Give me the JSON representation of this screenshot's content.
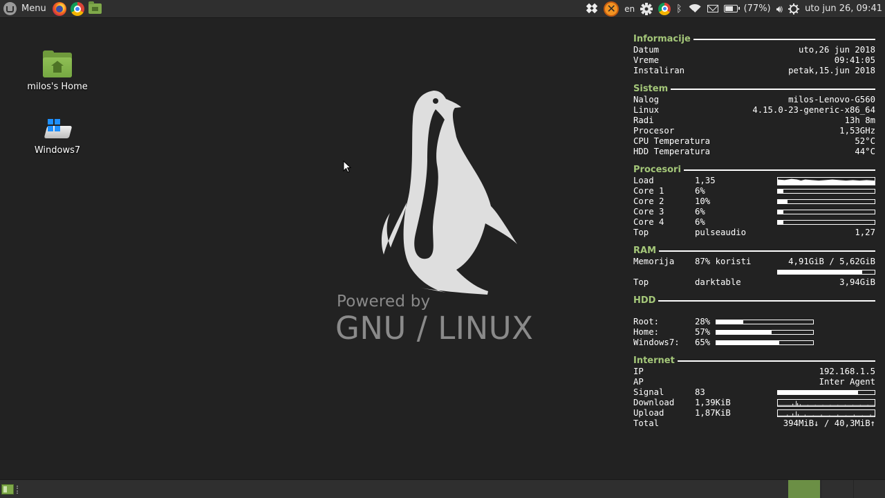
{
  "top_panel": {
    "menu_label": "Menu",
    "language": "en",
    "battery_text": "(77%)",
    "battery_level": 0.77,
    "clock": "uto jun 26, 09:41"
  },
  "desktop_icons": [
    {
      "label": "milos's Home",
      "icon": "home-folder-icon"
    },
    {
      "label": "Windows7",
      "icon": "windows-drive-icon"
    }
  ],
  "background": {
    "line1": "Powered by",
    "line2": "GNU / LINUX"
  },
  "conky": {
    "info": {
      "title": "Informacije",
      "rows": [
        {
          "label": "Datum",
          "value": "uto,26 jun 2018"
        },
        {
          "label": "Vreme",
          "value": "09:41:05"
        },
        {
          "label": "Instaliran",
          "value": "petak,15.jun 2018"
        }
      ]
    },
    "system": {
      "title": "Sistem",
      "rows": [
        {
          "label": "Nalog",
          "value": "milos-Lenovo-G560"
        },
        {
          "label": "Linux",
          "value": "4.15.0-23-generic-x86_64"
        },
        {
          "label": "Radi",
          "value": "13h 8m"
        },
        {
          "label": "Procesor",
          "value": "1,53GHz"
        },
        {
          "label": "CPU Temperatura",
          "value": "52°C"
        },
        {
          "label": "HDD Temperatura",
          "value": "44°C"
        }
      ]
    },
    "cpu": {
      "title": "Procesori",
      "load_label": "Load",
      "load_value": "1,35",
      "cores": [
        {
          "label": "Core 1",
          "value": "6%",
          "fraction": 0.06
        },
        {
          "label": "Core 2",
          "value": "10%",
          "fraction": 0.1
        },
        {
          "label": "Core 3",
          "value": "6%",
          "fraction": 0.06
        },
        {
          "label": "Core 4",
          "value": "6%",
          "fraction": 0.06
        }
      ],
      "top_label": "Top",
      "top_process": "pulseaudio",
      "top_value": "1,27"
    },
    "ram": {
      "title": "RAM",
      "mem_label": "Memorija",
      "mem_used": "87% koristi",
      "mem_value": "4,91GiB / 5,62GiB",
      "mem_fraction": 0.87,
      "top_label": "Top",
      "top_process": "darktable",
      "top_value": "3,94GiB"
    },
    "hdd": {
      "title": "HDD",
      "rows": [
        {
          "label": "Root:",
          "value": "28%",
          "fraction": 0.28
        },
        {
          "label": "Home:",
          "value": "57%",
          "fraction": 0.57
        },
        {
          "label": "Windows7:",
          "value": "65%",
          "fraction": 0.65
        }
      ]
    },
    "net": {
      "title": "Internet",
      "ip_label": "IP",
      "ip_value": "192.168.1.5",
      "ap_label": "AP",
      "ap_value": "Inter Agent",
      "signal_label": "Signal",
      "signal_value": "83",
      "signal_fraction": 0.83,
      "download_label": "Download",
      "download_value": "1,39KiB",
      "upload_label": "Upload",
      "upload_value": "1,87KiB",
      "total_label": "Total",
      "total_value": "394MiB↓ / 40,3MiB↑"
    }
  },
  "colors": {
    "panel": "#2f2f2f",
    "desktop": "#222222",
    "conky_heading": "#a4c779",
    "mint_green": "#6b8f45"
  }
}
